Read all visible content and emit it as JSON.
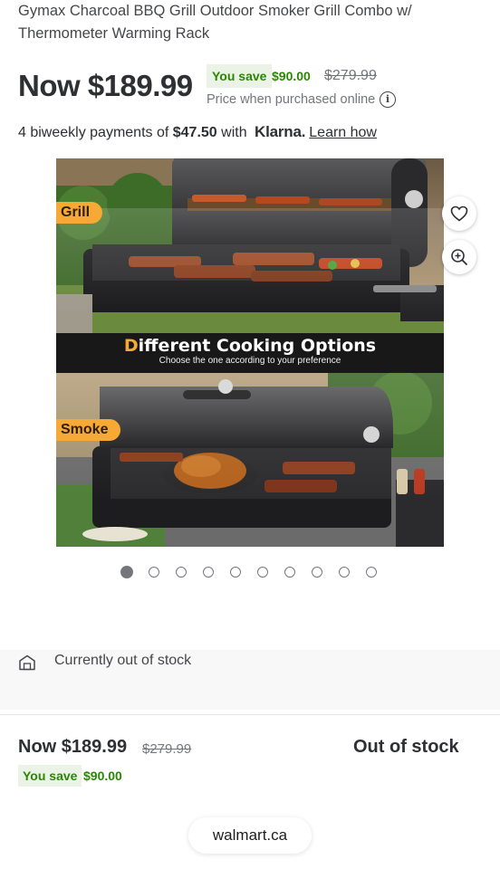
{
  "product": {
    "title": "Gymax Charcoal BBQ Grill Outdoor Smoker Grill Combo w/ Thermometer Warming Rack"
  },
  "price": {
    "now": "Now $189.99",
    "you_save_label": "You save",
    "save_amount": "$90.00",
    "was": "$279.99",
    "note": "Price when purchased online"
  },
  "klarna": {
    "prefix": "4 biweekly payments of ",
    "amount": "$47.50",
    "with": " with ",
    "brand": "Klarna.",
    "link": "Learn how"
  },
  "gallery": {
    "tag_top": "Grill",
    "tag_bottom": "Smoke",
    "banner_first_letter": "D",
    "banner_rest": "ifferent Cooking Options",
    "banner_sub": "Choose the one according to your preference",
    "dot_count": 10,
    "active_index": 0
  },
  "stock": {
    "status": "Currently out of stock"
  },
  "bottom_bar": {
    "now": "Now $189.99",
    "was": "$279.99",
    "you_save_label": "You save",
    "save_amount": "$90.00",
    "availability": "Out of stock"
  },
  "browser": {
    "domain": "walmart.ca"
  },
  "icons": {
    "favorite": "heart-icon",
    "zoom": "zoom-in-icon",
    "info": "info-icon",
    "store": "store-icon"
  },
  "colors": {
    "save_green": "#2a8703",
    "save_bg": "#eaf3e6",
    "tag_orange": "#f7a935",
    "text_dark": "#2e2f32",
    "text_muted": "#74767c"
  }
}
